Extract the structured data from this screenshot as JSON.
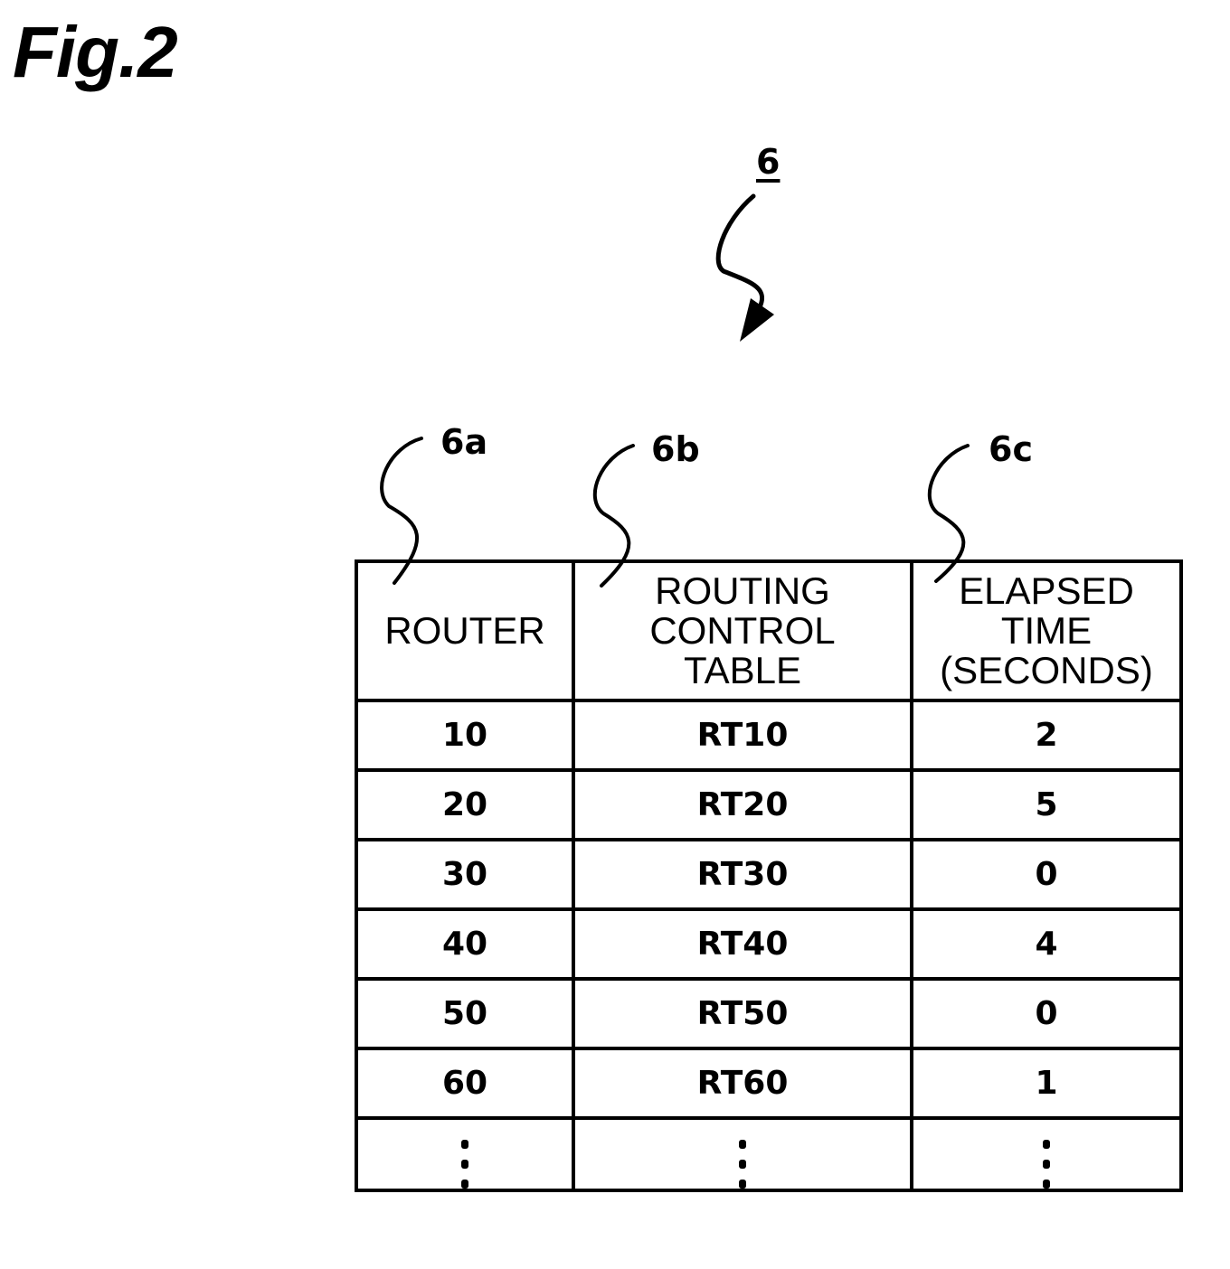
{
  "figure": {
    "title": "Fig.2",
    "main_reference": "6",
    "column_references": [
      "6a",
      "6b",
      "6c"
    ]
  },
  "table": {
    "headers": [
      "ROUTER",
      "ROUTING CONTROL TABLE",
      "ELAPSED TIME (SECONDS)"
    ],
    "header_lines": [
      [
        "ROUTER"
      ],
      [
        "ROUTING",
        "CONTROL",
        "TABLE"
      ],
      [
        "ELAPSED",
        "TIME",
        "(SECONDS)"
      ]
    ],
    "rows": [
      {
        "router": "10",
        "routing_control_table": "RT10",
        "elapsed_time": "2"
      },
      {
        "router": "20",
        "routing_control_table": "RT20",
        "elapsed_time": "5"
      },
      {
        "router": "30",
        "routing_control_table": "RT30",
        "elapsed_time": "0"
      },
      {
        "router": "40",
        "routing_control_table": "RT40",
        "elapsed_time": "4"
      },
      {
        "router": "50",
        "routing_control_table": "RT50",
        "elapsed_time": "0"
      },
      {
        "router": "60",
        "routing_control_table": "RT60",
        "elapsed_time": "1"
      }
    ],
    "continuation": "vertical-ellipsis"
  }
}
